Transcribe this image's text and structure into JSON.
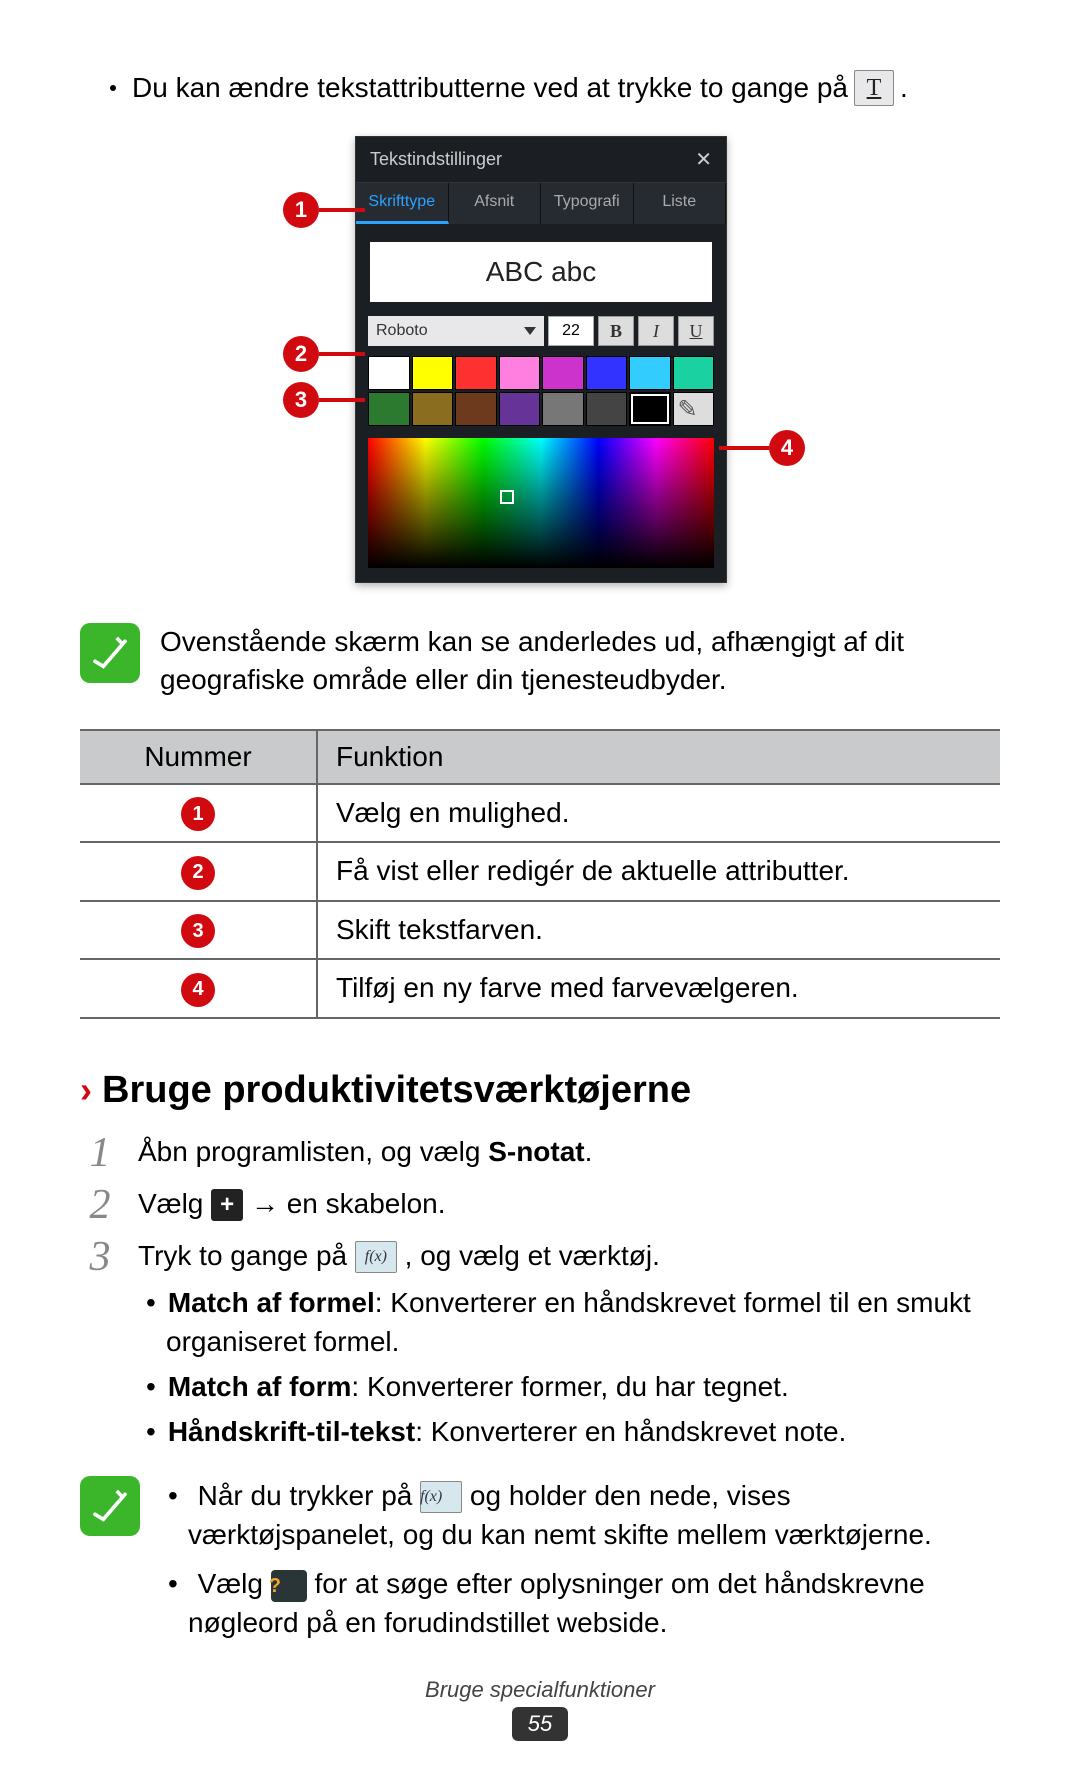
{
  "intro": {
    "prefix": "Du kan ændre tekstattributterne ved at trykke to gange på",
    "suffix": "."
  },
  "panel": {
    "title": "Tekstindstillinger",
    "tabs": [
      "Skrifttype",
      "Afsnit",
      "Typografi",
      "Liste"
    ],
    "preview": "ABC abc",
    "font_name": "Roboto",
    "font_size": "22",
    "bold": "B",
    "italic": "I",
    "underline": "U",
    "swatches_row1": [
      "#ffffff",
      "#ffff00",
      "#ff3030",
      "#ff7fe0",
      "#cc33cc",
      "#3333ff",
      "#33ccff",
      "#1ad1a1"
    ],
    "swatches_row2": [
      "#2b7a2f",
      "#8a6d1e",
      "#6e3a1e",
      "#663399",
      "#777777",
      "#444444",
      "#000000",
      "#EYEDROP"
    ]
  },
  "callouts": {
    "c1": "1",
    "c2": "2",
    "c3": "3",
    "c4": "4"
  },
  "note1": "Ovenstående skærm kan se anderledes ud, afhængigt af dit geografiske område eller din tjenesteudbyder.",
  "table": {
    "head": {
      "num": "Nummer",
      "func": "Funktion"
    },
    "rows": [
      {
        "n": "1",
        "f": "Vælg en mulighed."
      },
      {
        "n": "2",
        "f": "Få vist eller redigér de aktuelle attributter."
      },
      {
        "n": "3",
        "f": "Skift tekstfarven."
      },
      {
        "n": "4",
        "f": "Tilføj en ny farve med farvevælgeren."
      }
    ]
  },
  "section_heading": "Bruge produktivitetsværktøjerne",
  "steps": {
    "s1_a": "Åbn programlisten, og vælg ",
    "s1_b": "S-notat",
    "s1_c": ".",
    "s2_a": "Vælg ",
    "s2_b": " → en skabelon.",
    "s3_a": "Tryk to gange på ",
    "s3_b": ", og vælg et værktøj.",
    "b1_bold": "Match af formel",
    "b1_text": ": Konverterer en håndskrevet formel til en smukt organiseret formel.",
    "b2_bold": "Match af form",
    "b2_text": ": Konverterer former, du har tegnet.",
    "b3_bold": "Håndskrift-til-tekst",
    "b3_text": ": Konverterer en håndskrevet note."
  },
  "note2": {
    "l1_a": "Når du trykker på ",
    "l1_b": " og holder den nede, vises værktøjspanelet, og du kan nemt skifte mellem værktøjerne.",
    "l2_a": "Vælg ",
    "l2_b": " for at søge efter oplysninger om det håndskrevne nøgleord på en forudindstillet webside."
  },
  "footer": {
    "label": "Bruge specialfunktioner",
    "page": "55"
  },
  "fx_label": "f(x)"
}
